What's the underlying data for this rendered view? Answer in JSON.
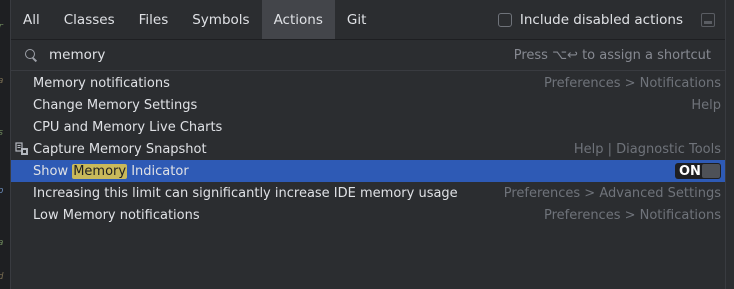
{
  "tabs": [
    {
      "label": "All",
      "active": false
    },
    {
      "label": "Classes",
      "active": false
    },
    {
      "label": "Files",
      "active": false
    },
    {
      "label": "Symbols",
      "active": false
    },
    {
      "label": "Actions",
      "active": true
    },
    {
      "label": "Git",
      "active": false
    }
  ],
  "include_disabled": {
    "label": "Include disabled actions",
    "checked": false
  },
  "search": {
    "value": "memory",
    "hint": "Press ⌥↩ to assign a shortcut"
  },
  "results": [
    {
      "label": "Memory notifications",
      "right": "Preferences > Notifications"
    },
    {
      "label": "Change Memory Settings",
      "right": "Help"
    },
    {
      "label": "CPU and Memory Live Charts",
      "right": ""
    },
    {
      "label": "Capture Memory Snapshot",
      "right": "Help | Diagnostic Tools",
      "icon": "memory-snapshot-icon"
    },
    {
      "label_prefix": "Show ",
      "label_highlight": "Memory",
      "label_suffix": " Indicator",
      "toggle": "ON",
      "selected": true
    },
    {
      "label": "Increasing this limit can significantly increase IDE memory usage",
      "right": "Preferences > Advanced Settings"
    },
    {
      "label": "Low Memory notifications",
      "right": "Preferences > Notifications"
    }
  ],
  "colors": {
    "background": "#2b2d30",
    "selected_row": "#2e5ab5",
    "highlight": "#c9b95a",
    "active_tab": "#43454a"
  }
}
